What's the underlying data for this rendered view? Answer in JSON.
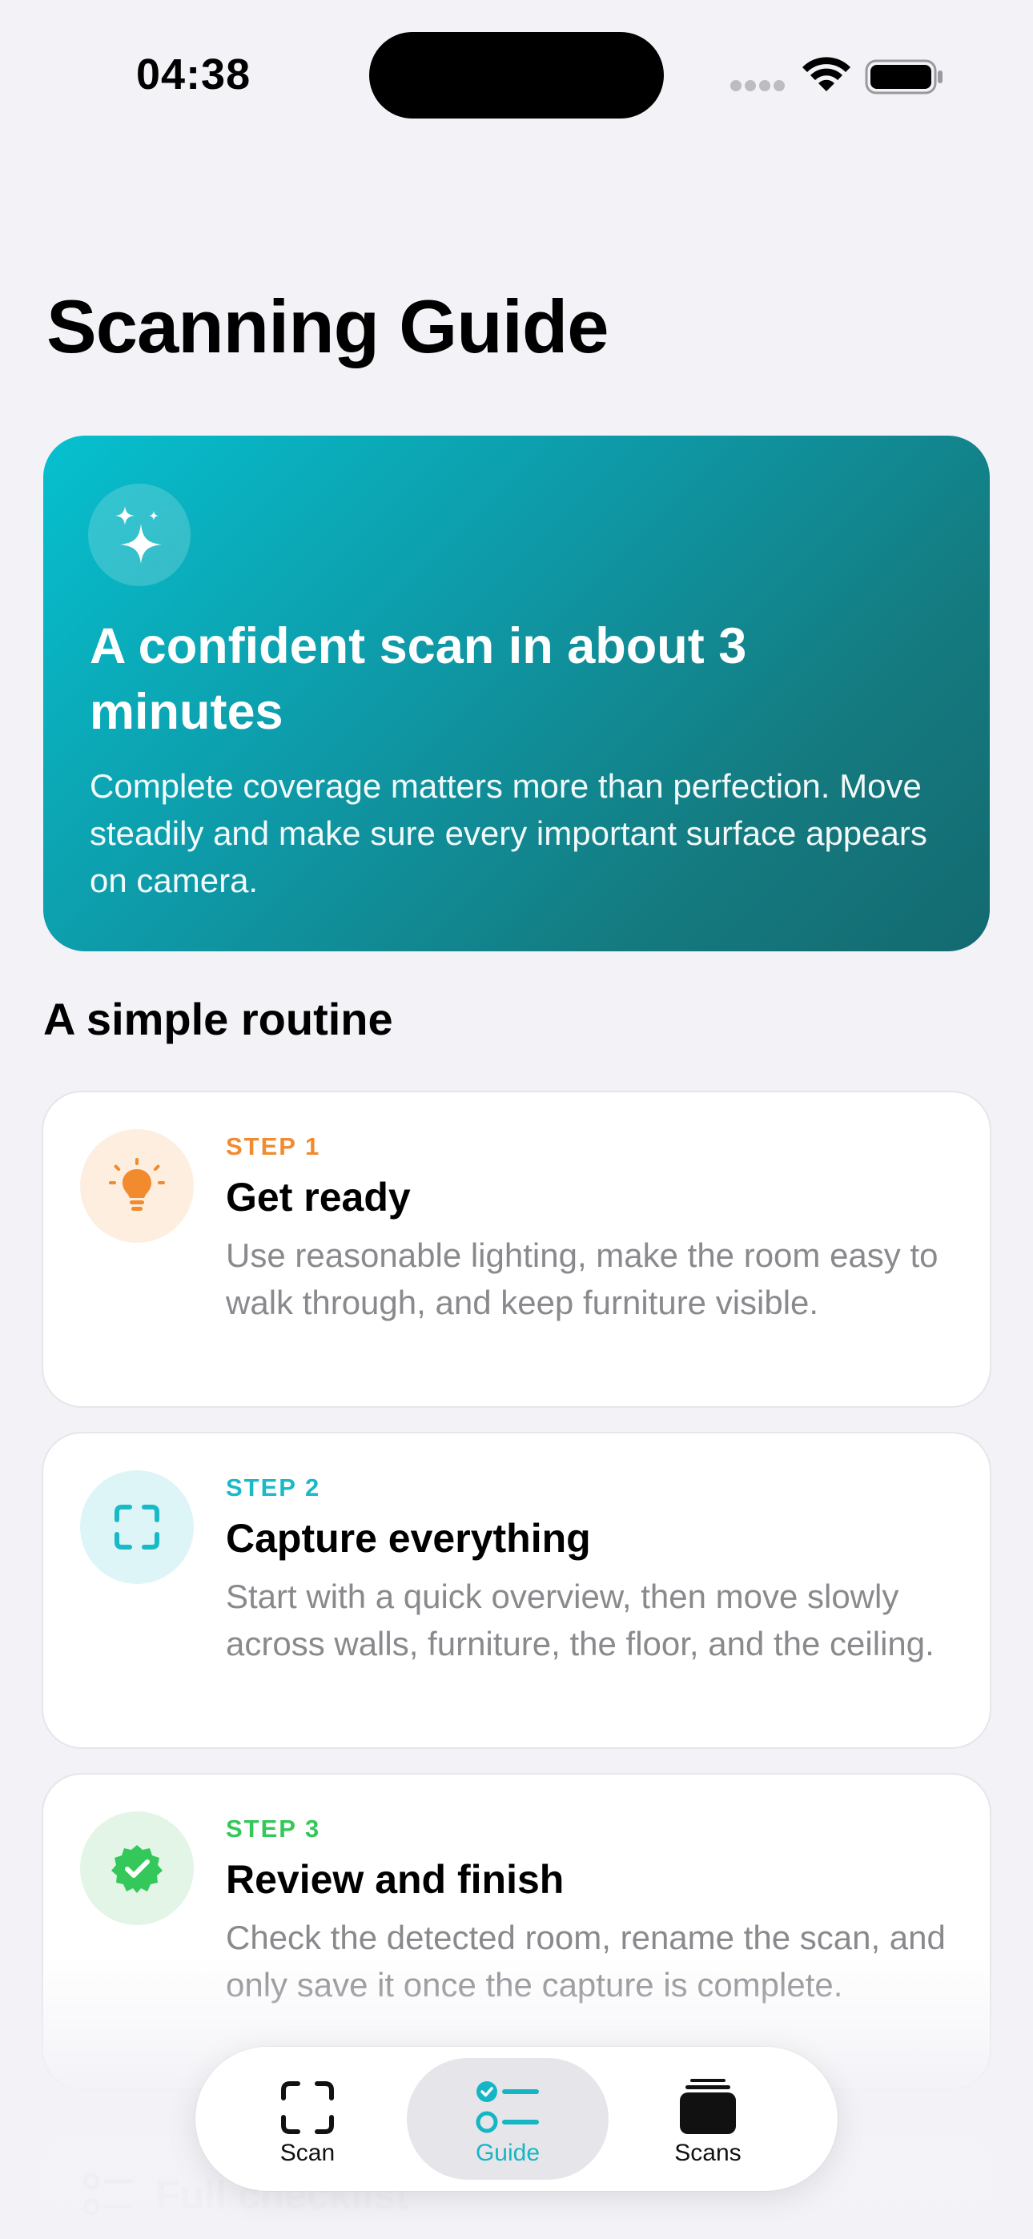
{
  "status_bar": {
    "time": "04:38"
  },
  "page": {
    "title": "Scanning Guide"
  },
  "hero": {
    "icon": "sparkles-icon",
    "title": "A confident scan in about 3 minutes",
    "description": "Complete coverage matters more than perfection. Move steadily and make sure every important surface appears on camera."
  },
  "routine": {
    "title": "A simple routine",
    "steps": [
      {
        "label": "STEP 1",
        "title": "Get ready",
        "description": "Use reasonable lighting, make the room easy to walk through, and keep furniture visible.",
        "icon": "lightbulb-icon",
        "color": "#f28a2e"
      },
      {
        "label": "STEP 2",
        "title": "Capture everything",
        "description": "Start with a quick overview, then move slowly across walls, furniture, the floor, and the ceiling.",
        "icon": "viewfinder-icon",
        "color": "#19b9c7"
      },
      {
        "label": "STEP 3",
        "title": "Review and finish",
        "description": "Check the detected room, rename the scan, and only save it once the capture is complete.",
        "icon": "checkmark-seal-icon",
        "color": "#34c759"
      }
    ]
  },
  "checklist": {
    "label": "Full checklist"
  },
  "tab_bar": {
    "tabs": [
      {
        "label": "Scan",
        "icon": "viewfinder-icon",
        "active": false
      },
      {
        "label": "Guide",
        "icon": "list-checklist-icon",
        "active": true
      },
      {
        "label": "Scans",
        "icon": "stack-icon",
        "active": false
      }
    ]
  },
  "colors": {
    "accent": "#15b6c4",
    "background": "#f2f2f7"
  }
}
